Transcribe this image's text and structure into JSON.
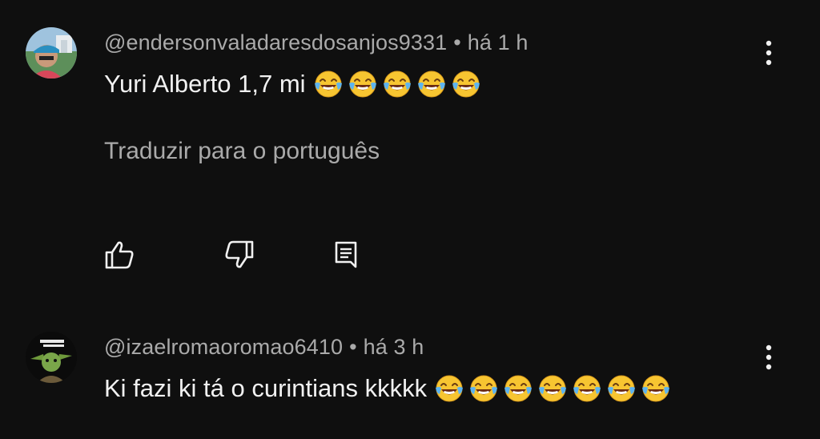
{
  "comments": [
    {
      "author": "@endersonvaladaresdosanjos9331",
      "separator": "•",
      "time": "há 1 h",
      "text": "Yuri Alberto 1,7 mi",
      "emoji": "face-with-tears-of-joy",
      "emoji_count": 5,
      "translate_label": "Traduzir para o português",
      "actions": [
        "like",
        "dislike",
        "reply"
      ]
    },
    {
      "author": "@izaelromaoromao6410",
      "separator": "•",
      "time": "há 3 h",
      "text": "Ki fazi ki tá o curintians kkkkk",
      "emoji": "face-with-tears-of-joy",
      "emoji_count": 7
    }
  ],
  "colors": {
    "background": "#0f0f0f",
    "primary_text": "#f1f1f1",
    "secondary_text": "#aaaaaa",
    "emoji_yellow": "#f7c531",
    "emoji_tears": "#5db4f0"
  },
  "icons": {
    "like": "thumbs-up-icon",
    "dislike": "thumbs-down-icon",
    "reply": "comment-icon",
    "more": "more-vertical-icon"
  }
}
